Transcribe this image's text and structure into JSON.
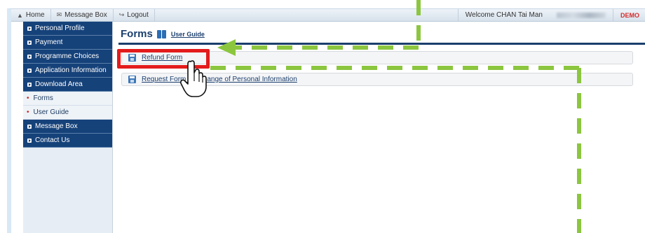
{
  "topbar": {
    "home": "Home",
    "message_box": "Message Box",
    "logout": "Logout",
    "welcome": "Welcome CHAN Tai Man",
    "demo": "DEMO"
  },
  "sidebar": {
    "items": [
      {
        "label": "Personal Profile"
      },
      {
        "label": "Payment"
      },
      {
        "label": "Programme Choices"
      },
      {
        "label": "Application Information"
      },
      {
        "label": "Download Area"
      },
      {
        "label": "Forms"
      },
      {
        "label": "User Guide"
      },
      {
        "label": "Message Box"
      },
      {
        "label": "Contact Us"
      }
    ]
  },
  "main": {
    "title": "Forms",
    "user_guide": "User Guide",
    "rows": [
      {
        "label": "Refund Form"
      },
      {
        "label": "Request Form for Change of Personal Information"
      }
    ]
  },
  "annotation": {
    "highlight_color": "#e31b1b",
    "arrow_color": "#8cc63f"
  },
  "icons": [
    "home-icon",
    "message-box-icon",
    "logout-icon",
    "book-icon",
    "floppy-disk-icon",
    "pointer-hand-icon",
    "menu-bullet-icon"
  ]
}
